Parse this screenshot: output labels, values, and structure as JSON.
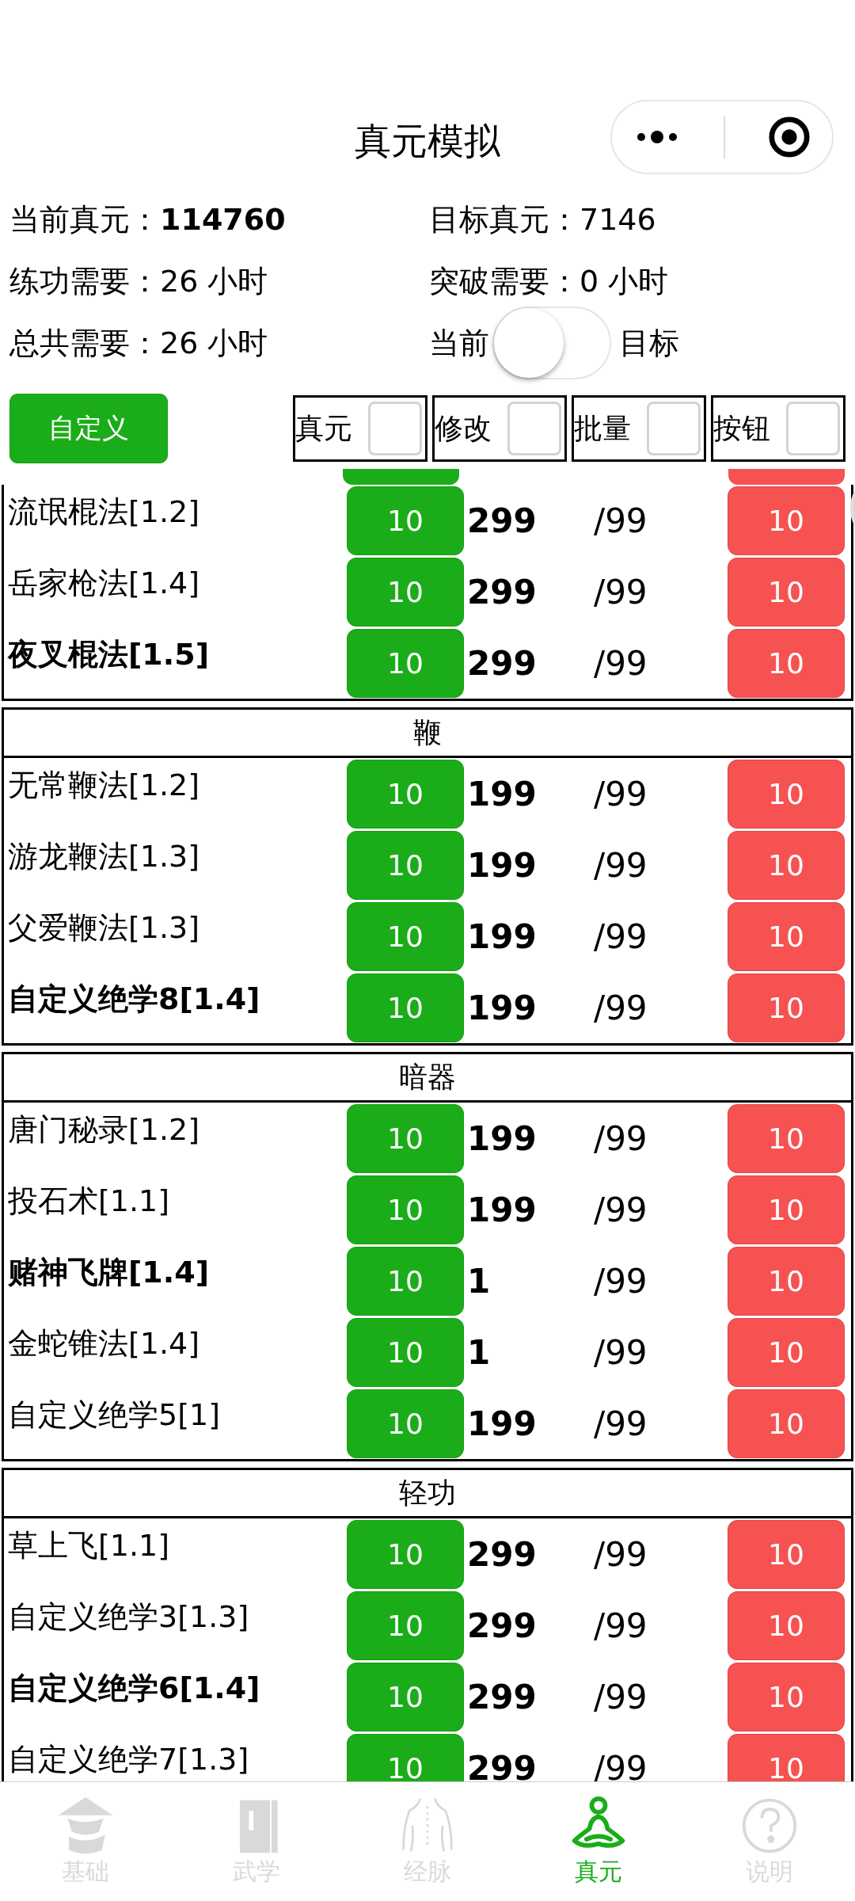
{
  "header": {
    "title": "真元模拟"
  },
  "stats": [
    {
      "label": "当前真元：",
      "value": "114760",
      "bold": true
    },
    {
      "label": "目标真元：",
      "value": "7146",
      "bold": false
    },
    {
      "label": "练功需要：",
      "value": "26 小时",
      "bold": false
    },
    {
      "label": "突破需要：",
      "value": "0 小时",
      "bold": false
    },
    {
      "label": "总共需要：",
      "value": "26 小时",
      "bold": false
    }
  ],
  "toggle": {
    "left_label": "当前",
    "right_label": "目标",
    "on": false
  },
  "custom_button": "自定义",
  "options": [
    {
      "label": "真元",
      "checked": false
    },
    {
      "label": "修改",
      "checked": false
    },
    {
      "label": "批量",
      "checked": false
    },
    {
      "label": "按钮",
      "checked": false
    }
  ],
  "groups": [
    {
      "rows": [
        {
          "name": "流氓棍法[1.2]",
          "bold": false,
          "add": "10",
          "value": "299",
          "max": "/99",
          "sub": "10"
        },
        {
          "name": "岳家枪法[1.4]",
          "bold": false,
          "add": "10",
          "value": "299",
          "max": "/99",
          "sub": "10"
        },
        {
          "name": "夜叉棍法[1.5]",
          "bold": true,
          "add": "10",
          "value": "299",
          "max": "/99",
          "sub": "10"
        }
      ]
    },
    {
      "category": "鞭",
      "rows": [
        {
          "name": "无常鞭法[1.2]",
          "bold": false,
          "add": "10",
          "value": "199",
          "max": "/99",
          "sub": "10"
        },
        {
          "name": "游龙鞭法[1.3]",
          "bold": false,
          "add": "10",
          "value": "199",
          "max": "/99",
          "sub": "10"
        },
        {
          "name": "父爱鞭法[1.3]",
          "bold": false,
          "add": "10",
          "value": "199",
          "max": "/99",
          "sub": "10"
        },
        {
          "name": "自定义绝学8[1.4]",
          "bold": true,
          "add": "10",
          "value": "199",
          "max": "/99",
          "sub": "10"
        }
      ]
    },
    {
      "category": "暗器",
      "rows": [
        {
          "name": "唐门秘录[1.2]",
          "bold": false,
          "add": "10",
          "value": "199",
          "max": "/99",
          "sub": "10"
        },
        {
          "name": "投石术[1.1]",
          "bold": false,
          "add": "10",
          "value": "199",
          "max": "/99",
          "sub": "10"
        },
        {
          "name": "赌神飞牌[1.4]",
          "bold": true,
          "add": "10",
          "value": "1",
          "max": "/99",
          "sub": "10"
        },
        {
          "name": "金蛇锥法[1.4]",
          "bold": false,
          "add": "10",
          "value": "1",
          "max": "/99",
          "sub": "10"
        },
        {
          "name": "自定义绝学5[1]",
          "bold": false,
          "add": "10",
          "value": "199",
          "max": "/99",
          "sub": "10"
        }
      ]
    },
    {
      "category": "轻功",
      "rows": [
        {
          "name": "草上飞[1.1]",
          "bold": false,
          "add": "10",
          "value": "299",
          "max": "/99",
          "sub": "10"
        },
        {
          "name": "自定义绝学3[1.3]",
          "bold": false,
          "add": "10",
          "value": "299",
          "max": "/99",
          "sub": "10"
        },
        {
          "name": "自定义绝学6[1.4]",
          "bold": true,
          "add": "10",
          "value": "299",
          "max": "/99",
          "sub": "10"
        },
        {
          "name": "自定义绝学7[1.3]",
          "bold": false,
          "add": "10",
          "value": "299",
          "max": "/99",
          "sub": "10"
        }
      ]
    }
  ],
  "tabs": [
    {
      "label": "基础",
      "kind": "hat",
      "selected": false
    },
    {
      "label": "武学",
      "kind": "book",
      "selected": false
    },
    {
      "label": "经脉",
      "kind": "back",
      "selected": false
    },
    {
      "label": "真元",
      "kind": "meditate",
      "selected": true
    },
    {
      "label": "说明",
      "kind": "help",
      "selected": false
    }
  ]
}
